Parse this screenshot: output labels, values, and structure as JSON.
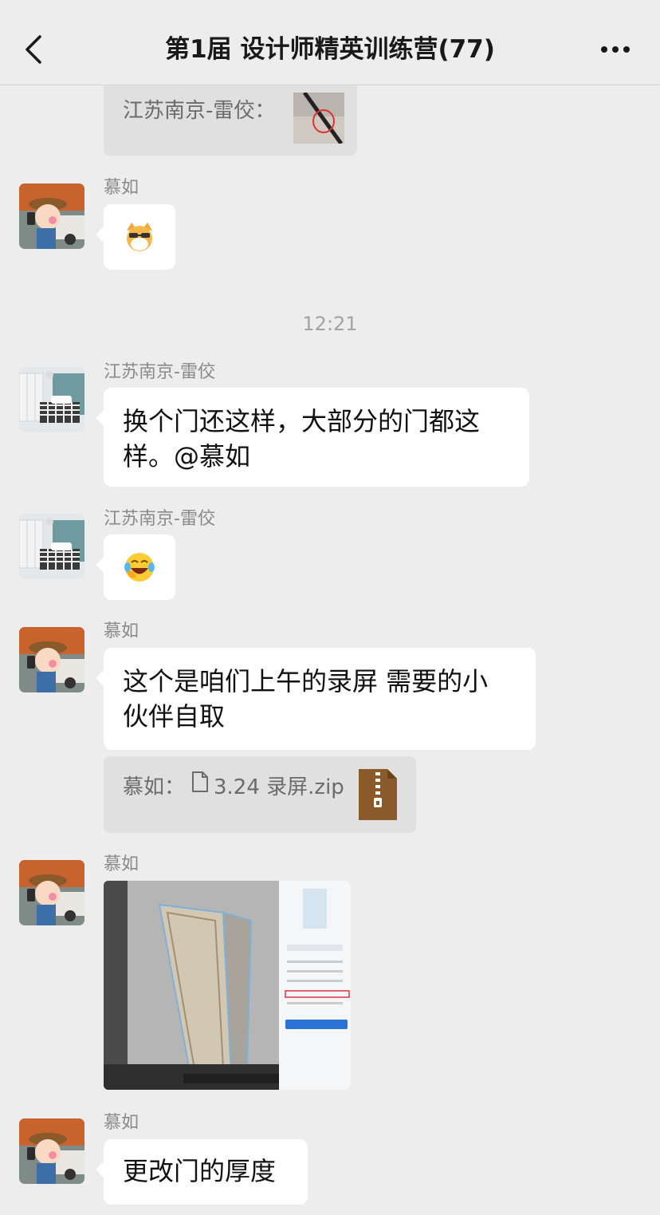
{
  "header": {
    "title": "第1届 设计师精英训练营(77)"
  },
  "messages": {
    "q1": {
      "text": "江苏南京-雷佼："
    },
    "m1": {
      "sender": "慕如",
      "emoji": "cat-sunglasses-emoji"
    },
    "time1": "12:21",
    "m2": {
      "sender": "江苏南京-雷佼",
      "text_line1": "换个门还这样，大部分的门都这",
      "text_line2": "样。@慕如"
    },
    "m3": {
      "sender": "江苏南京-雷佼",
      "emoji": "laughing-crying-emoji"
    },
    "m4": {
      "sender": "慕如",
      "text_line1": "这个是咱们上午的录屏 需要的小",
      "text_line2": "伙伴自取"
    },
    "q2": {
      "prefix": "慕如：",
      "filename": "3.24 录屏.zip"
    },
    "m5": {
      "sender": "慕如"
    },
    "m6": {
      "sender": "慕如",
      "text": "更改门的厚度"
    }
  },
  "colors": {
    "background": "#ededed",
    "bubble": "#ffffff",
    "quote": "#e0e0e0",
    "zip_icon": "#8b5a2b"
  }
}
